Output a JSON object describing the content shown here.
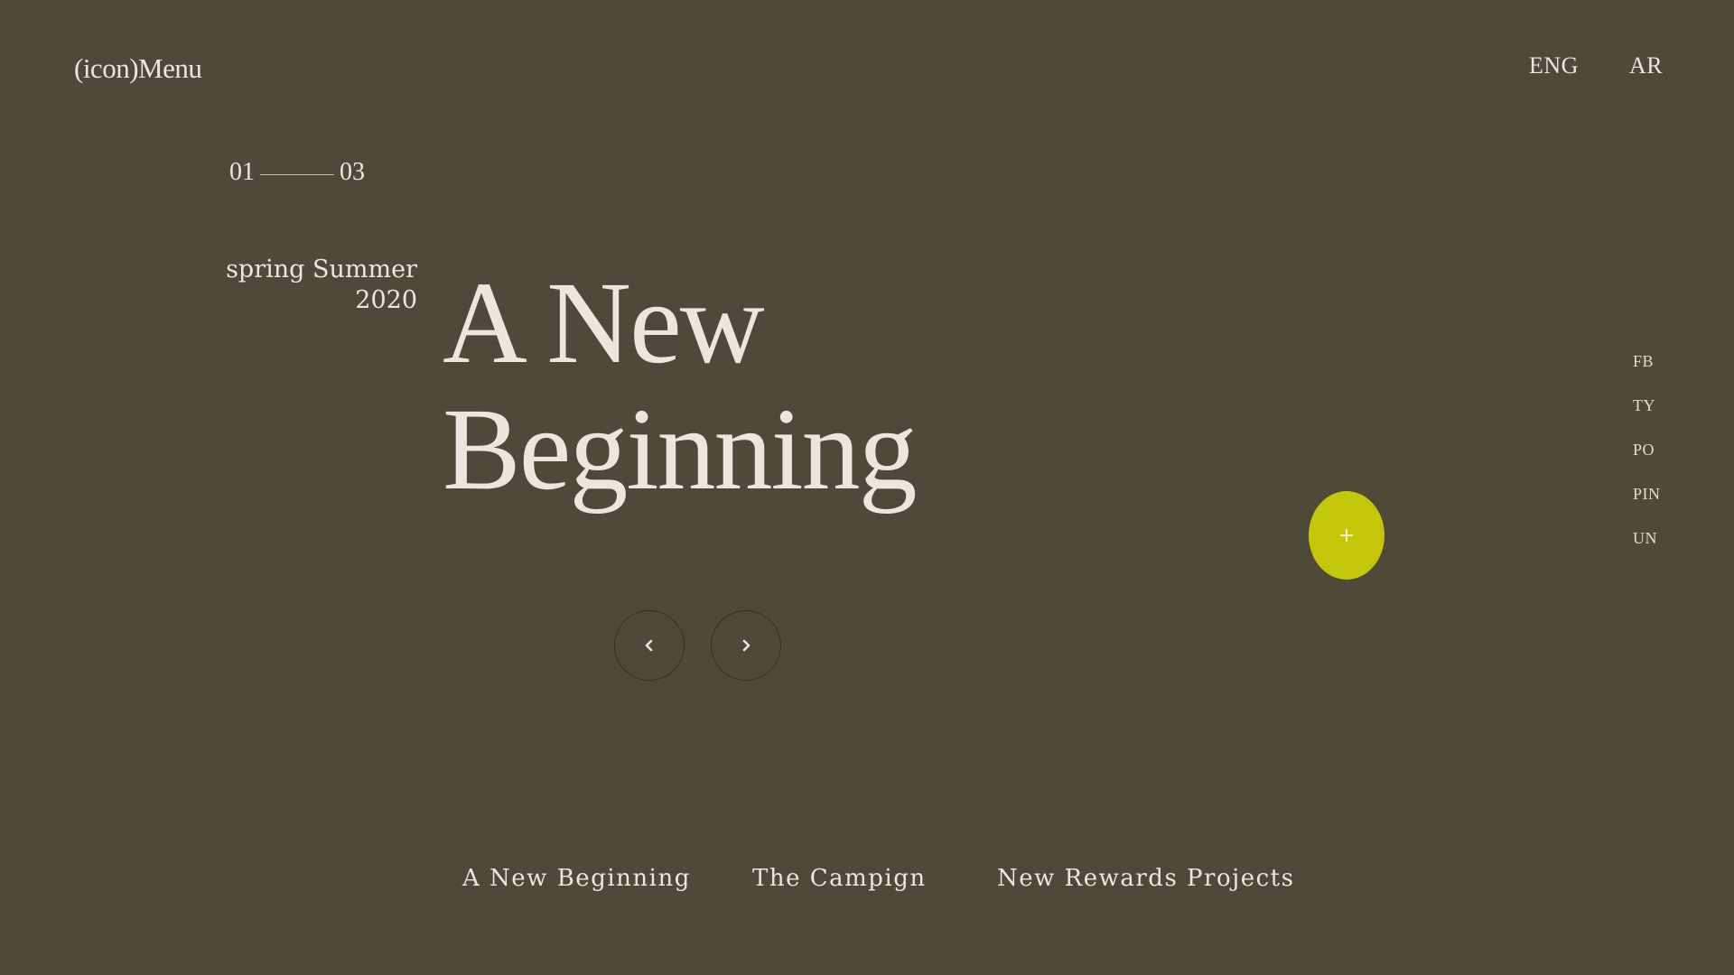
{
  "header": {
    "menu_label": "(icon)Menu",
    "languages": [
      "ENG",
      "AR"
    ]
  },
  "slider": {
    "current": "01",
    "total": "03"
  },
  "season": {
    "line1": "spring Summer",
    "line2": "2020"
  },
  "headline": {
    "line1": "A New",
    "line2": "Beginning"
  },
  "controls": {
    "prev_icon": "chevron-left-icon",
    "next_icon": "chevron-right-icon",
    "plus_label": "+"
  },
  "social": [
    "FB",
    "TY",
    "PO",
    "PIN",
    "UN"
  ],
  "bottom_nav": [
    "A New Beginning",
    "The Campign",
    "New Rewards Projects"
  ],
  "colors": {
    "background": "#4f4939",
    "text": "#ece6dc",
    "accent": "#c3c609"
  }
}
